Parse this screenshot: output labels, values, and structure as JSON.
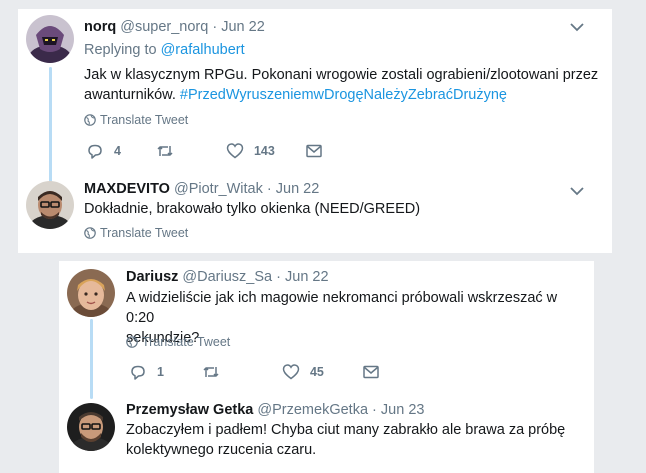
{
  "tweets": [
    {
      "name": "norq",
      "handle": "@super_norq",
      "dot": "·",
      "time": "Jun 22",
      "replying_prefix": "Replying to",
      "replying_to": "@rafalhubert",
      "text_line1": "Jak w klasycznym RPGu. Pokonani wrogowie zostali ograbieni/zlootowani przez",
      "text_line2_plain": "awanturników.",
      "hashtag": "#PrzedWyruszeniemwDrogęNależyZebraćDrużynę",
      "translate": "Translate Tweet",
      "replies": "4",
      "likes": "143"
    },
    {
      "name": "MAXDEVITO",
      "handle": "@Piotr_Witak",
      "dot": "·",
      "time": "Jun 22",
      "text_line1": "Dokładnie, brakowało tylko okienka (NEED/GREED)",
      "translate": "Translate Tweet"
    },
    {
      "name": "Dariusz",
      "handle": "@Dariusz_Sa",
      "dot": "·",
      "time": "Jun 22",
      "text_line1": "A widzieliście jak ich magowie nekromanci próbowali wskrzeszać w 0:20",
      "text_line2": "sekundzie?",
      "translate": "Translate Tweet",
      "replies": "1",
      "likes": "45"
    },
    {
      "name": "Przemysław Getka",
      "handle": "@PrzemekGetka",
      "dot": "·",
      "time": "Jun 23",
      "text_line1": "Zobaczyłem i padłem! Chyba ciut many zabrakło ale brawa za próbę",
      "text_line2": "kolektywnego rzucenia czaru."
    }
  ],
  "icons": {
    "caret": "chevron-down-icon",
    "reply": "reply-icon",
    "retweet": "retweet-icon",
    "like": "heart-icon",
    "dm": "envelope-icon",
    "translate": "globe-icon"
  },
  "colors": {
    "link": "#1b95e0",
    "muted": "#657786",
    "thread": "#b8dcf5"
  }
}
